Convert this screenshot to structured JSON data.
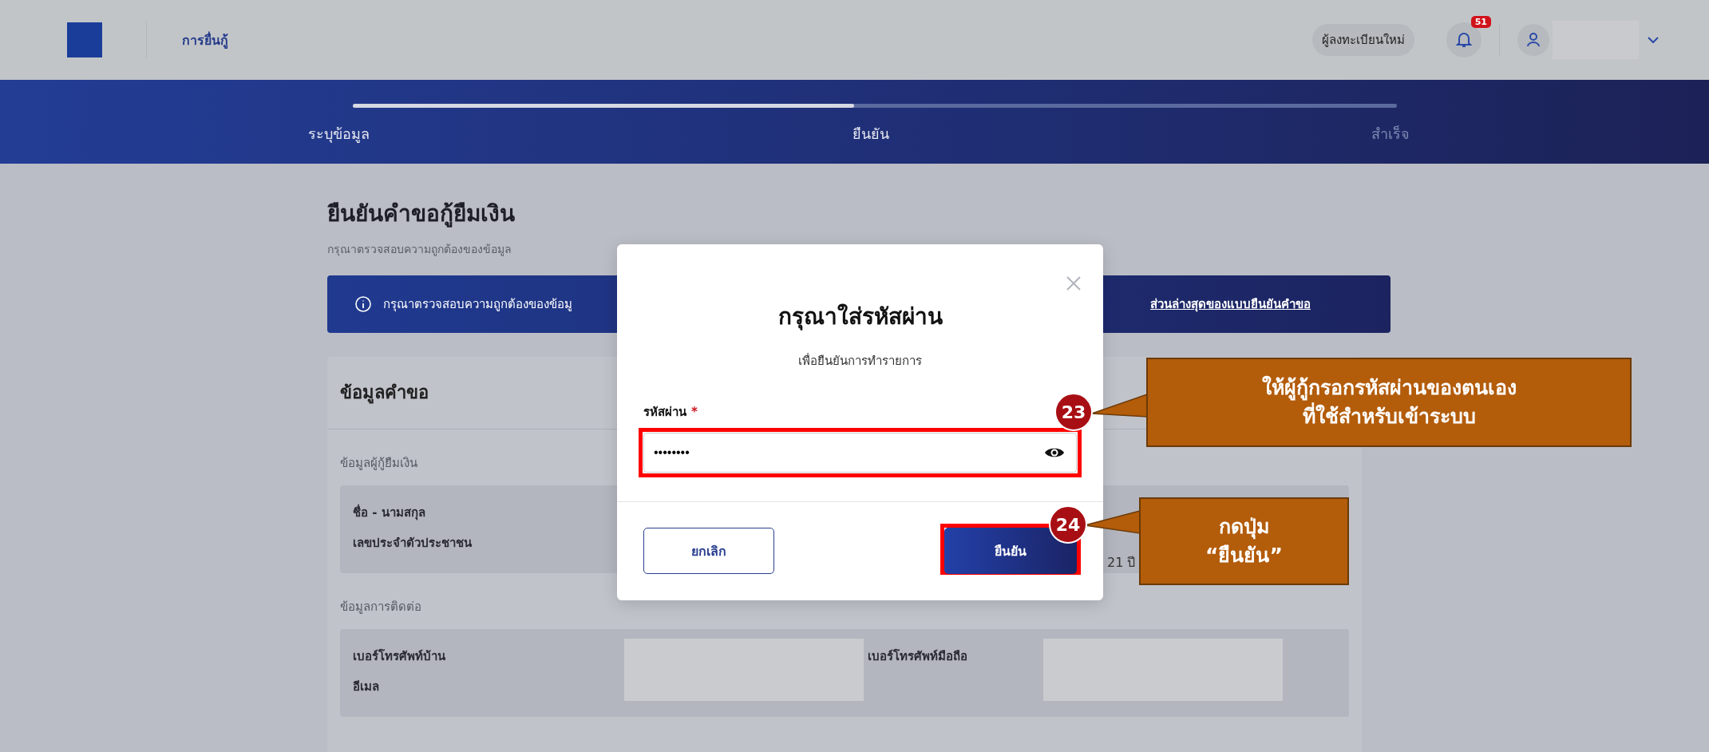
{
  "header": {
    "section": "การยื่นกู้",
    "role_badge": "ผู้ลงทะเบียนใหม่",
    "notification_count": "51"
  },
  "stepper": {
    "level": 0.48,
    "steps": [
      {
        "label": "ระบุข้อมูล",
        "reached": true
      },
      {
        "label": "ยืนยัน",
        "reached": true
      },
      {
        "label": "สำเร็จ",
        "reached": false
      }
    ]
  },
  "page": {
    "title": "ยืนยันคำขอกู้ยืมเงิน",
    "subtitle": "กรุณาตรวจสอบความถูกต้องของข้อมูล"
  },
  "notice": {
    "text": "กรุณาตรวจสอบความถูกต้องของข้อมู",
    "link": "ส่วนล่างสุดของแบบยืนยันคำขอ"
  },
  "card": {
    "title": "ข้อมูลคำขอ",
    "borrower": {
      "title": "ข้อมูลผู้กู้ยืมเงิน",
      "labels": [
        "ชื่อ - นามสกุล",
        "เลขประจำตัวประชาชน"
      ],
      "age": "21 ปี"
    },
    "contact": {
      "title": "ข้อมูลการติดต่อ",
      "labels": [
        "เบอร์โทรศัพท์บ้าน",
        "อีเมล"
      ],
      "mobile_label": "เบอร์โทรศัพท์มือถือ"
    }
  },
  "dialog": {
    "title": "กรุณาใส่รหัสผ่าน",
    "subtitle": "เพื่อยืนยันการทำรายการ",
    "field": {
      "label": "รหัสผ่าน",
      "required_mark": "*",
      "value": "••••••••"
    },
    "buttons": [
      {
        "label": "ยกเลิก",
        "kind": "secondary"
      },
      {
        "label": "ยืนยัน",
        "kind": "primary"
      }
    ]
  },
  "annotations": [
    {
      "number": "23",
      "text": "ให้ผู้กู้กรอกรหัสผ่านของตนเอง\nที่ใช้สำหรับเข้าระบบ"
    },
    {
      "number": "24",
      "text": "กดปุ่ม\n“ยืนยัน”"
    }
  ]
}
